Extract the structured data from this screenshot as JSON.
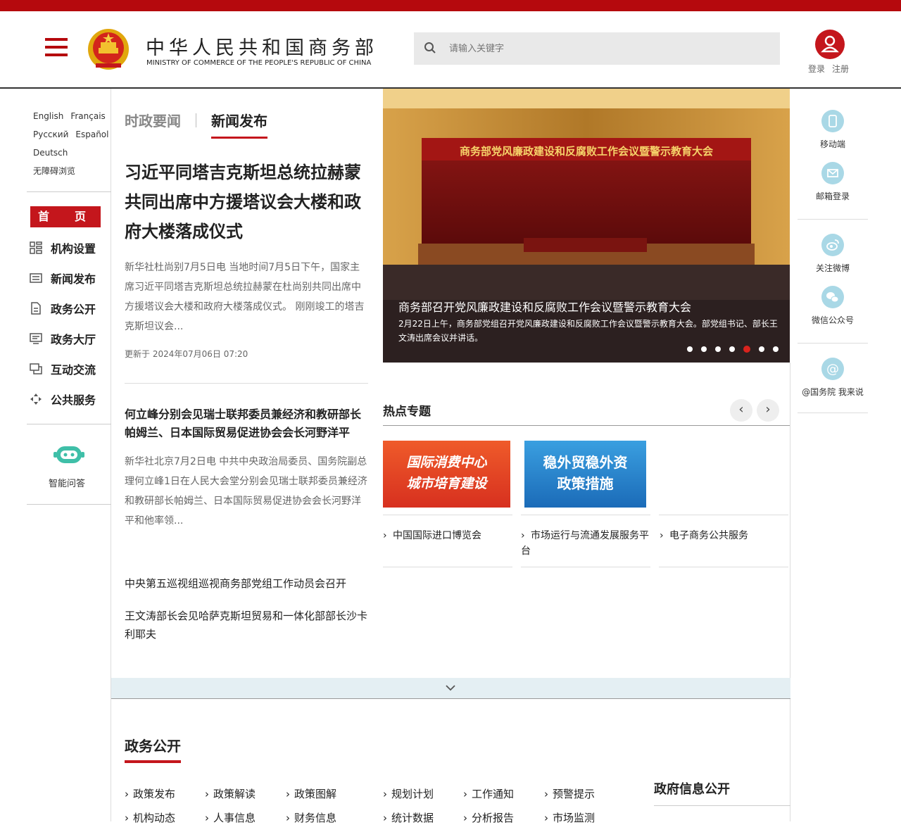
{
  "header": {
    "title": "中华人民共和国商务部",
    "subtitle": "MINISTRY OF COMMERCE OF THE PEOPLE'S REPUBLIC OF CHINA",
    "search_placeholder": "请输入关键字",
    "login": "登录",
    "register": "注册",
    "brand_color": "#b5090d"
  },
  "languages": [
    "English",
    "Français",
    "Русский",
    "Español",
    "Deutsch",
    "无障碍浏览"
  ],
  "nav": {
    "home": "首　页",
    "items": [
      {
        "label": "机构设置",
        "icon": "org-grid-icon"
      },
      {
        "label": "新闻发布",
        "icon": "news-icon"
      },
      {
        "label": "政务公开",
        "icon": "document-icon"
      },
      {
        "label": "政务大厅",
        "icon": "hall-icon"
      },
      {
        "label": "互动交流",
        "icon": "chat-icon"
      },
      {
        "label": "公共服务",
        "icon": "service-icon"
      }
    ],
    "assistant": "智能问答"
  },
  "news": {
    "tab1": "时政要闻",
    "tab2": "新闻发布",
    "lead_title": "习近平同塔吉克斯坦总统拉赫蒙共同出席中方援塔议会大楼和政府大楼落成仪式",
    "lead_summary": "新华社杜尚别7月5日电 当地时间7月5日下午，国家主席习近平同塔吉克斯坦总统拉赫蒙在杜尚别共同出席中方援塔议会大楼和政府大楼落成仪式。 刚刚竣工的塔吉克斯坦议会...",
    "lead_time": "更新于 2024年07月06日 07:20",
    "second_title": "何立峰分别会见瑞士联邦委员兼经济和教研部长帕姆兰、日本国际贸易促进协会会长河野洋平",
    "second_summary": "新华社北京7月2日电 中共中央政治局委员、国务院副总理何立峰1日在人民大会堂分别会见瑞士联邦委员兼经济和教研部长帕姆兰、日本国际贸易促进协会会长河野洋平和他率领...",
    "links": [
      "中央第五巡视组巡视商务部党组工作动员会召开",
      "王文涛部长会见哈萨克斯坦贸易和一体化部部长沙卡利耶夫"
    ]
  },
  "banner": {
    "stage_text": "商务部党风廉政建设和反腐败工作会议暨警示教育大会",
    "caption_title": "商务部召开党风廉政建设和反腐败工作会议暨警示教育大会",
    "caption_text": "2月22日上午，商务部党组召开党风廉政建设和反腐败工作会议暨警示教育大会。部党组书记、部长王文涛出席会议并讲话。",
    "dots": 7,
    "active_dot": 5
  },
  "hot": {
    "title": "热点专题",
    "topics": [
      {
        "line1": "国际消费中心",
        "line2": "城市培育建设"
      },
      {
        "line1": "稳外贸稳外资",
        "line2": "政策措施"
      }
    ],
    "links": [
      "中国国际进口博览会",
      "市场运行与流通发展服务平台",
      "电子商务公共服务"
    ]
  },
  "right": {
    "items": [
      "移动端",
      "邮箱登录",
      "关注微博",
      "微信公众号",
      "@国务院 我来说"
    ]
  },
  "zw": {
    "title": "政务公开",
    "row1": [
      "政策发布",
      "政策解读",
      "政策图解",
      "规划计划",
      "工作通知",
      "预警提示"
    ],
    "row2": [
      "机构动态",
      "人事信息",
      "财务信息",
      "统计数据",
      "分析报告",
      "市场监测"
    ],
    "info_title": "政府信息公开"
  }
}
